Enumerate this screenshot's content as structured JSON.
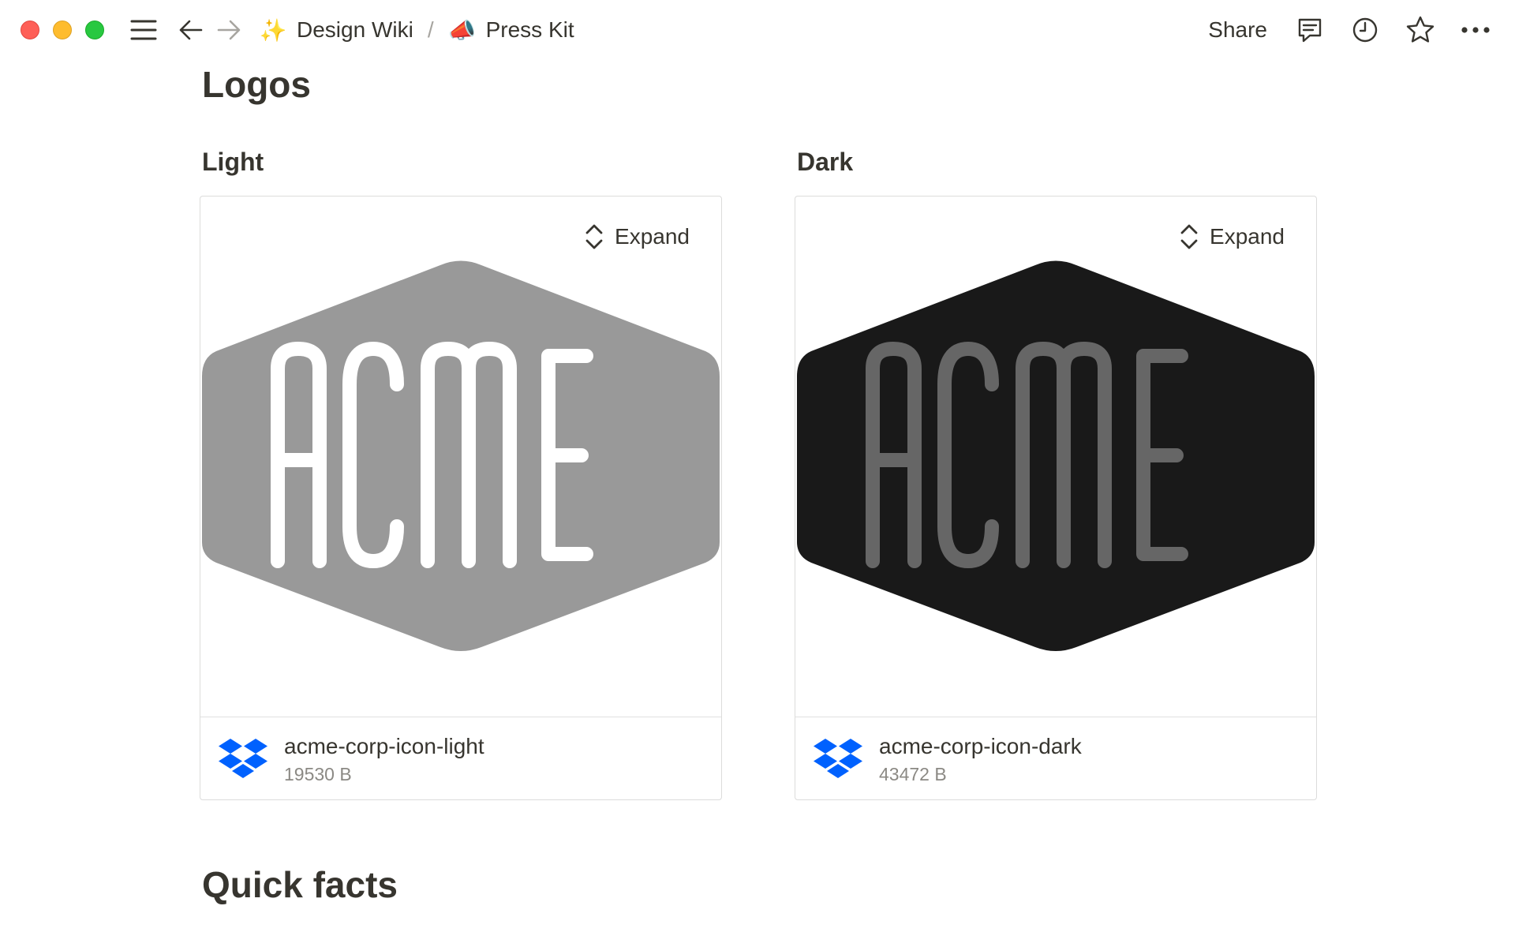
{
  "window": {
    "breadcrumbs": [
      {
        "emoji": "✨",
        "label": "Design Wiki"
      },
      {
        "emoji": "📣",
        "label": "Press Kit"
      }
    ],
    "breadcrumb_separator": "/",
    "share_label": "Share"
  },
  "page": {
    "section_title": "Logos",
    "bottom_section_title": "Quick facts"
  },
  "logos": [
    {
      "heading": "Light",
      "expand_label": "Expand",
      "logo_text": "ACME",
      "badge_color": "#999999",
      "text_color": "#ffffff",
      "file_name": "acme-corp-icon-light",
      "file_size": "19530 B"
    },
    {
      "heading": "Dark",
      "expand_label": "Expand",
      "logo_text": "ACME",
      "badge_color": "#191919",
      "text_color": "#666666",
      "file_name": "acme-corp-icon-dark",
      "file_size": "43472 B"
    }
  ],
  "colors": {
    "text": "#37352f",
    "muted": "#8b8984",
    "dropbox": "#0061fe"
  }
}
